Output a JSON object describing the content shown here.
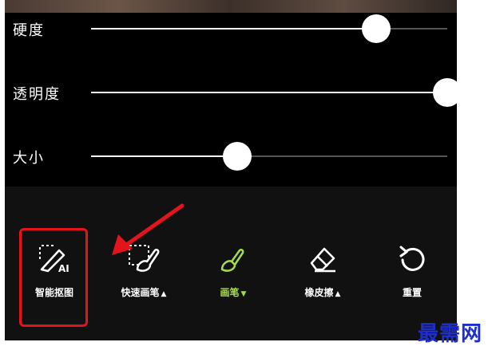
{
  "sliders": [
    {
      "label": "硬度",
      "value": 0.8
    },
    {
      "label": "透明度",
      "value": 1.0
    },
    {
      "label": "大小",
      "value": 0.41
    }
  ],
  "tools": [
    {
      "label": "智能抠图",
      "icon": "ai-cutout-icon",
      "selected": false,
      "highlighted": true
    },
    {
      "label": "快速画笔",
      "icon": "quick-brush-icon",
      "arrow": "▲",
      "selected": false
    },
    {
      "label": "画笔",
      "icon": "brush-icon",
      "arrow": "▼",
      "selected": true
    },
    {
      "label": "橡皮擦",
      "icon": "eraser-icon",
      "arrow": "▲",
      "selected": false
    },
    {
      "label": "重置",
      "icon": "reset-icon",
      "selected": false
    }
  ],
  "colors": {
    "accent_green": "#a6dc4a",
    "highlight_red": "#e3141b",
    "watermark_blue": "#1d2fc8"
  },
  "watermark": "最需网"
}
